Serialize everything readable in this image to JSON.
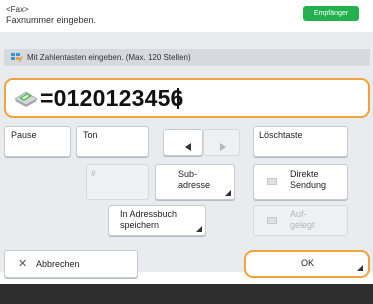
{
  "header": {
    "mode_label": "<Fax>",
    "instruction": "Faxnummer eingeben.",
    "recipient_button": "Empfänger"
  },
  "hint": {
    "text": "Mit Zahlentasten eingeben. (Max. 120 Stellen)",
    "icon": "numeric-keypad-icon"
  },
  "number_field": {
    "value": "=0120123456",
    "icon": "fax-machine-icon"
  },
  "keys": {
    "pause": "Pause",
    "tone": "Ton",
    "clear": "Löschtaste",
    "symbol": "#",
    "subaddress_line1": "Sub-",
    "subaddress_line2": "adresse",
    "direct_send_line1": "Direkte",
    "direct_send_line2": "Sendung",
    "save_addressbook_line1": "In Adressbuch",
    "save_addressbook_line2": "speichern",
    "on_hook_line1": "Auf-",
    "on_hook_line2": "gelegt"
  },
  "footer": {
    "cancel": "Abbrechen",
    "ok": "OK"
  },
  "colors": {
    "accent_orange": "#f0a23c",
    "recipient_green": "#22b14c"
  }
}
